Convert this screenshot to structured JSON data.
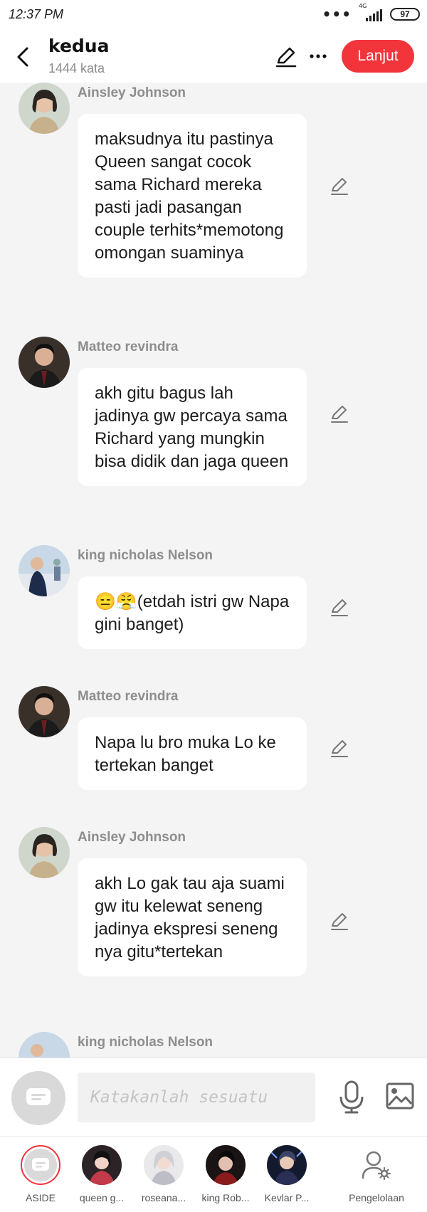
{
  "status": {
    "time": "12:37 PM",
    "network": "4G",
    "battery": "97"
  },
  "header": {
    "title": "kedua",
    "subtitle": "1444 kata",
    "continue_label": "Lanjut"
  },
  "messages": [
    {
      "name": "Ainsley Johnson",
      "text": "maksudnya itu pastinya Queen sangat cocok sama Richard mereka pasti jadi pasangan couple terhits*memotong omongan suaminya"
    },
    {
      "name": "Matteo revindra",
      "text": "akh gitu bagus lah jadinya gw percaya sama Richard yang mungkin bisa didik dan jaga queen"
    },
    {
      "name": "king nicholas Nelson",
      "text": "😑😤(etdah istri gw Napa gini banget)"
    },
    {
      "name": "Matteo revindra",
      "text": "Napa lu bro muka Lo ke tertekan banget"
    },
    {
      "name": "Ainsley Johnson",
      "text": "akh Lo gak tau aja suami gw itu kelewat seneng jadinya ekspresi seneng nya gitu*tertekan"
    },
    {
      "name": "king nicholas Nelson",
      "text": ""
    }
  ],
  "input": {
    "placeholder": "Katakanlah sesuatu"
  },
  "nav": [
    {
      "label": "ASIDE"
    },
    {
      "label": "queen g..."
    },
    {
      "label": "roseana..."
    },
    {
      "label": "king Rob..."
    },
    {
      "label": "Kevlar P..."
    },
    {
      "label": "Pengelolaan"
    }
  ],
  "colors": {
    "accent": "#f2353b",
    "background": "#f4f4f4",
    "name": "#8e8e8e"
  }
}
